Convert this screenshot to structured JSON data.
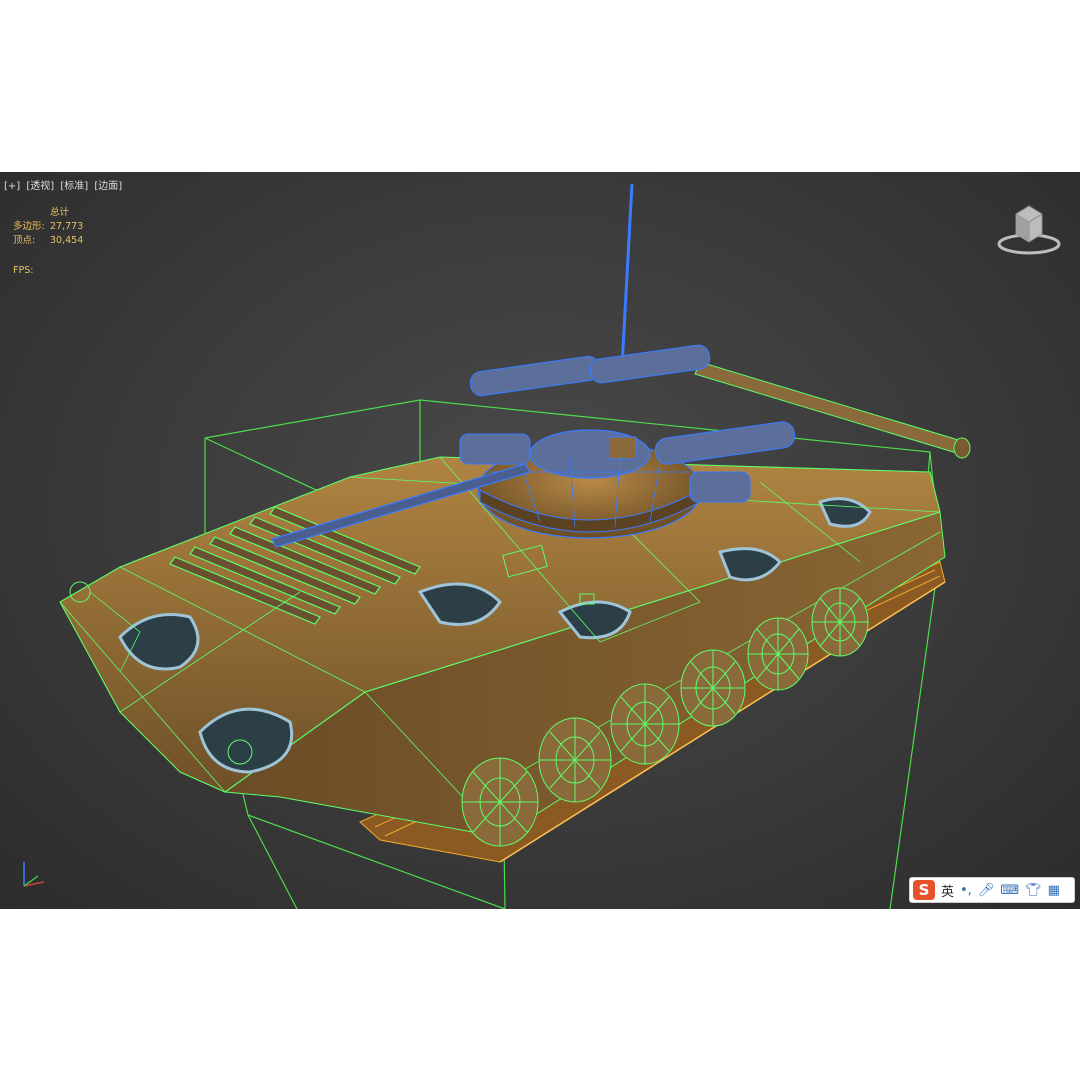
{
  "viewport_menu": {
    "plus": "[+]",
    "view": "[透视]",
    "shading": "[标准]",
    "mode": "[边面]"
  },
  "stats": {
    "header": "总计",
    "polys_label": "多边形:",
    "polys_value": "27,773",
    "verts_label": "顶点:",
    "verts_value": "30,454",
    "fps_label": "FPS:"
  },
  "ime_toolbar": {
    "logo": "S",
    "language": "英",
    "punct_icon": "punctuation-icon",
    "mic_icon": "microphone-icon",
    "keyboard_icon": "keyboard-icon",
    "skin_icon": "shirt-icon",
    "apps_icon": "apps-grid-icon"
  },
  "colors": {
    "viewport_bg": "#3a3a3a",
    "stats_text": "#e8c060",
    "wire_green": "#5cff6a",
    "wire_blue": "#3a7bff",
    "wire_orange": "#f0a830",
    "camo_tan": "#a07838",
    "camo_blue": "#9fc4d8",
    "ime_red": "#e8502a"
  }
}
